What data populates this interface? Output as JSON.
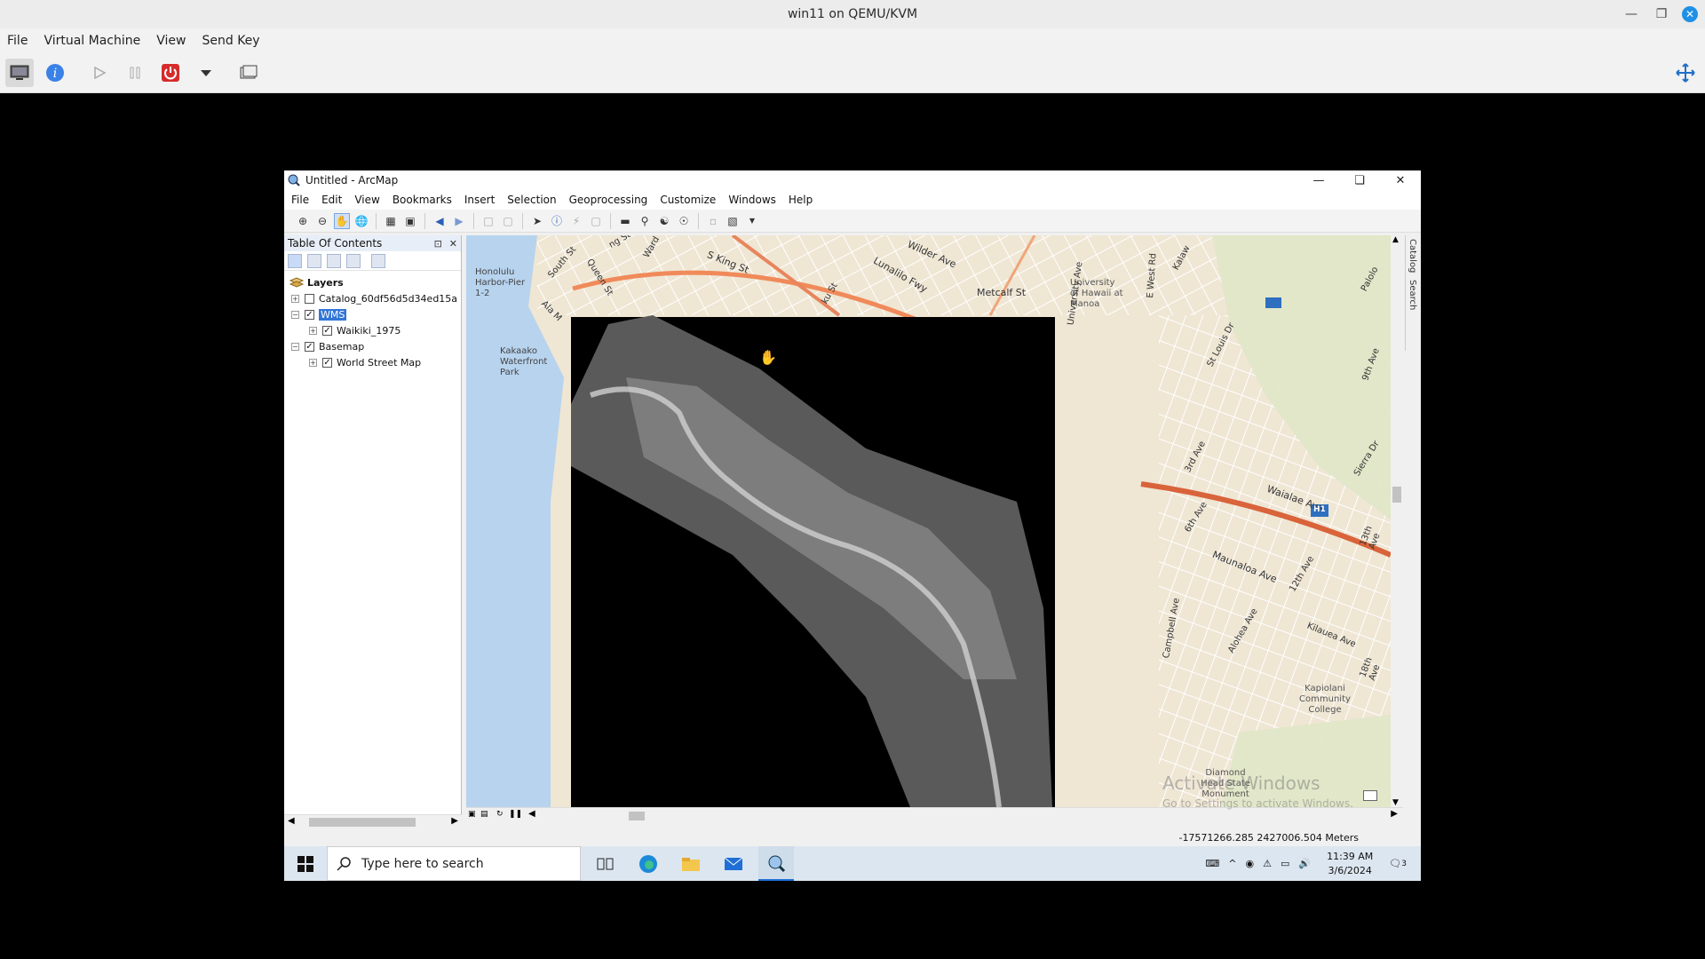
{
  "host": {
    "title": "win11 on QEMU/KVM",
    "menu": [
      "File",
      "Virtual Machine",
      "View",
      "Send Key"
    ]
  },
  "arcmap": {
    "title": "Untitled - ArcMap",
    "menu": [
      "File",
      "Edit",
      "View",
      "Bookmarks",
      "Insert",
      "Selection",
      "Geoprocessing",
      "Customize",
      "Windows",
      "Help"
    ],
    "toc_title": "Table Of Contents",
    "tree": {
      "root": "Layers",
      "catalog_layer": "Catalog_60df56d5d34ed15a",
      "wms_layer": "WMS",
      "wms_child": "Waikiki_1975",
      "basemap": "Basemap",
      "basemap_child": "World Street Map"
    },
    "right_dock": [
      "Catalog",
      "Search"
    ],
    "status_coords": "-17571266.285  2427006.504 Meters"
  },
  "map_labels": {
    "l1": "Honolulu Harbor-Pier 1-2",
    "l2": "Kakaako Waterfront Park",
    "l3": "University of Hawaii at Manoa",
    "l4": "Metcalf St",
    "l5": "S King St",
    "l6": "Wilder Ave",
    "l7": "Kapiolani Community College",
    "l8": "Diamond Head State Monument",
    "l9": "Waialae Ave",
    "l10": "Maunaloa Ave",
    "l11": "H1",
    "l12": "6th Ave",
    "l13": "Kilauea Ave",
    "l14": "Sierra Dr",
    "l15": "Campbell Ave",
    "l16": "Alohea Ave",
    "l17": "12th Ave",
    "l18": "3rd Ave",
    "l19": "St Louis Dr",
    "l20": "E West Rd",
    "l21": "Kalaw",
    "l22": "Palolo",
    "l23": "13th Ave",
    "l24": "18th Ave",
    "l25": "Queen St",
    "l26": "South St",
    "l27": "Ala M",
    "l28": "Lunalilo Fwy",
    "l29": "ku St",
    "l30": "University Ave",
    "l31": "9th Ave",
    "l32": "Ward",
    "l33": "ng St"
  },
  "watermark": {
    "line1": "Activate Windows",
    "line2": "Go to Settings to activate Windows."
  },
  "taskbar": {
    "search_placeholder": "Type here to search",
    "time": "11:39 AM",
    "date": "3/6/2024",
    "notif_count": "3"
  }
}
